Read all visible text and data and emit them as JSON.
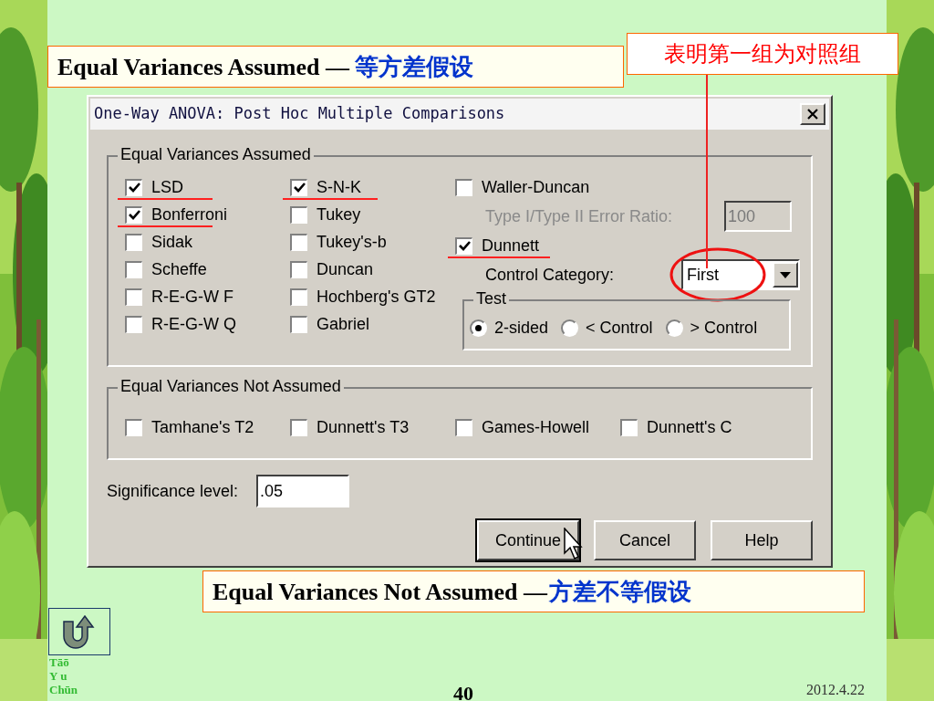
{
  "heading_top": {
    "text": "Equal Variances Assumed — ",
    "text_cn": "等方差假设"
  },
  "callout": "表明第一组为对照组",
  "dialog": {
    "title": "One-Way ANOVA: Post Hoc Multiple Comparisons",
    "equal_assumed": {
      "label": "Equal Variances Assumed",
      "columns": [
        [
          {
            "label": "LSD",
            "checked": true,
            "marked": true
          },
          {
            "label": "Bonferroni",
            "checked": true,
            "marked": true
          },
          {
            "label": "Sidak",
            "checked": false,
            "marked": false
          },
          {
            "label": "Scheffe",
            "checked": false,
            "marked": false
          },
          {
            "label": "R-E-G-W F",
            "checked": false,
            "marked": false
          },
          {
            "label": "R-E-G-W Q",
            "checked": false,
            "marked": false
          }
        ],
        [
          {
            "label": "S-N-K",
            "checked": true,
            "marked": true
          },
          {
            "label": "Tukey",
            "checked": false,
            "marked": false
          },
          {
            "label": "Tukey's-b",
            "checked": false,
            "marked": false
          },
          {
            "label": "Duncan",
            "checked": false,
            "marked": false
          },
          {
            "label": "Hochberg's GT2",
            "checked": false,
            "marked": false
          },
          {
            "label": "Gabriel",
            "checked": false,
            "marked": false
          }
        ]
      ],
      "waller": {
        "label": "Waller-Duncan",
        "checked": false,
        "marked": false
      },
      "ratio": {
        "label": "Type I/Type II Error Ratio:",
        "value": "100",
        "disabled": true
      },
      "dunnett": {
        "label": "Dunnett",
        "checked": true,
        "marked": true
      },
      "control_category": {
        "label": "Control Category:",
        "value": "First",
        "circled": true
      },
      "test": {
        "label": "Test",
        "options": [
          {
            "label": "2-sided",
            "selected": true
          },
          {
            "label": "< Control",
            "selected": false
          },
          {
            "label": "> Control",
            "selected": false
          }
        ]
      }
    },
    "not_assumed": {
      "label": "Equal Variances Not Assumed",
      "options": [
        {
          "label": "Tamhane's T2",
          "checked": false
        },
        {
          "label": "Dunnett's T3",
          "checked": false
        },
        {
          "label": "Games-Howell",
          "checked": false
        },
        {
          "label": "Dunnett's C",
          "checked": false
        }
      ]
    },
    "significance": {
      "label": "Significance level:",
      "value": ".05"
    },
    "buttons": [
      {
        "label": "Continue",
        "focused": true
      },
      {
        "label": "Cancel",
        "focused": false
      },
      {
        "label": "Help",
        "focused": false
      }
    ]
  },
  "heading_bottom": {
    "text": "Equal Variances Not Assumed —",
    "text_cn": "方差不等假设"
  },
  "logo": [
    "Tāō",
    "Y u",
    "Chūn"
  ],
  "page_number": "40",
  "date": "2012.4.22"
}
